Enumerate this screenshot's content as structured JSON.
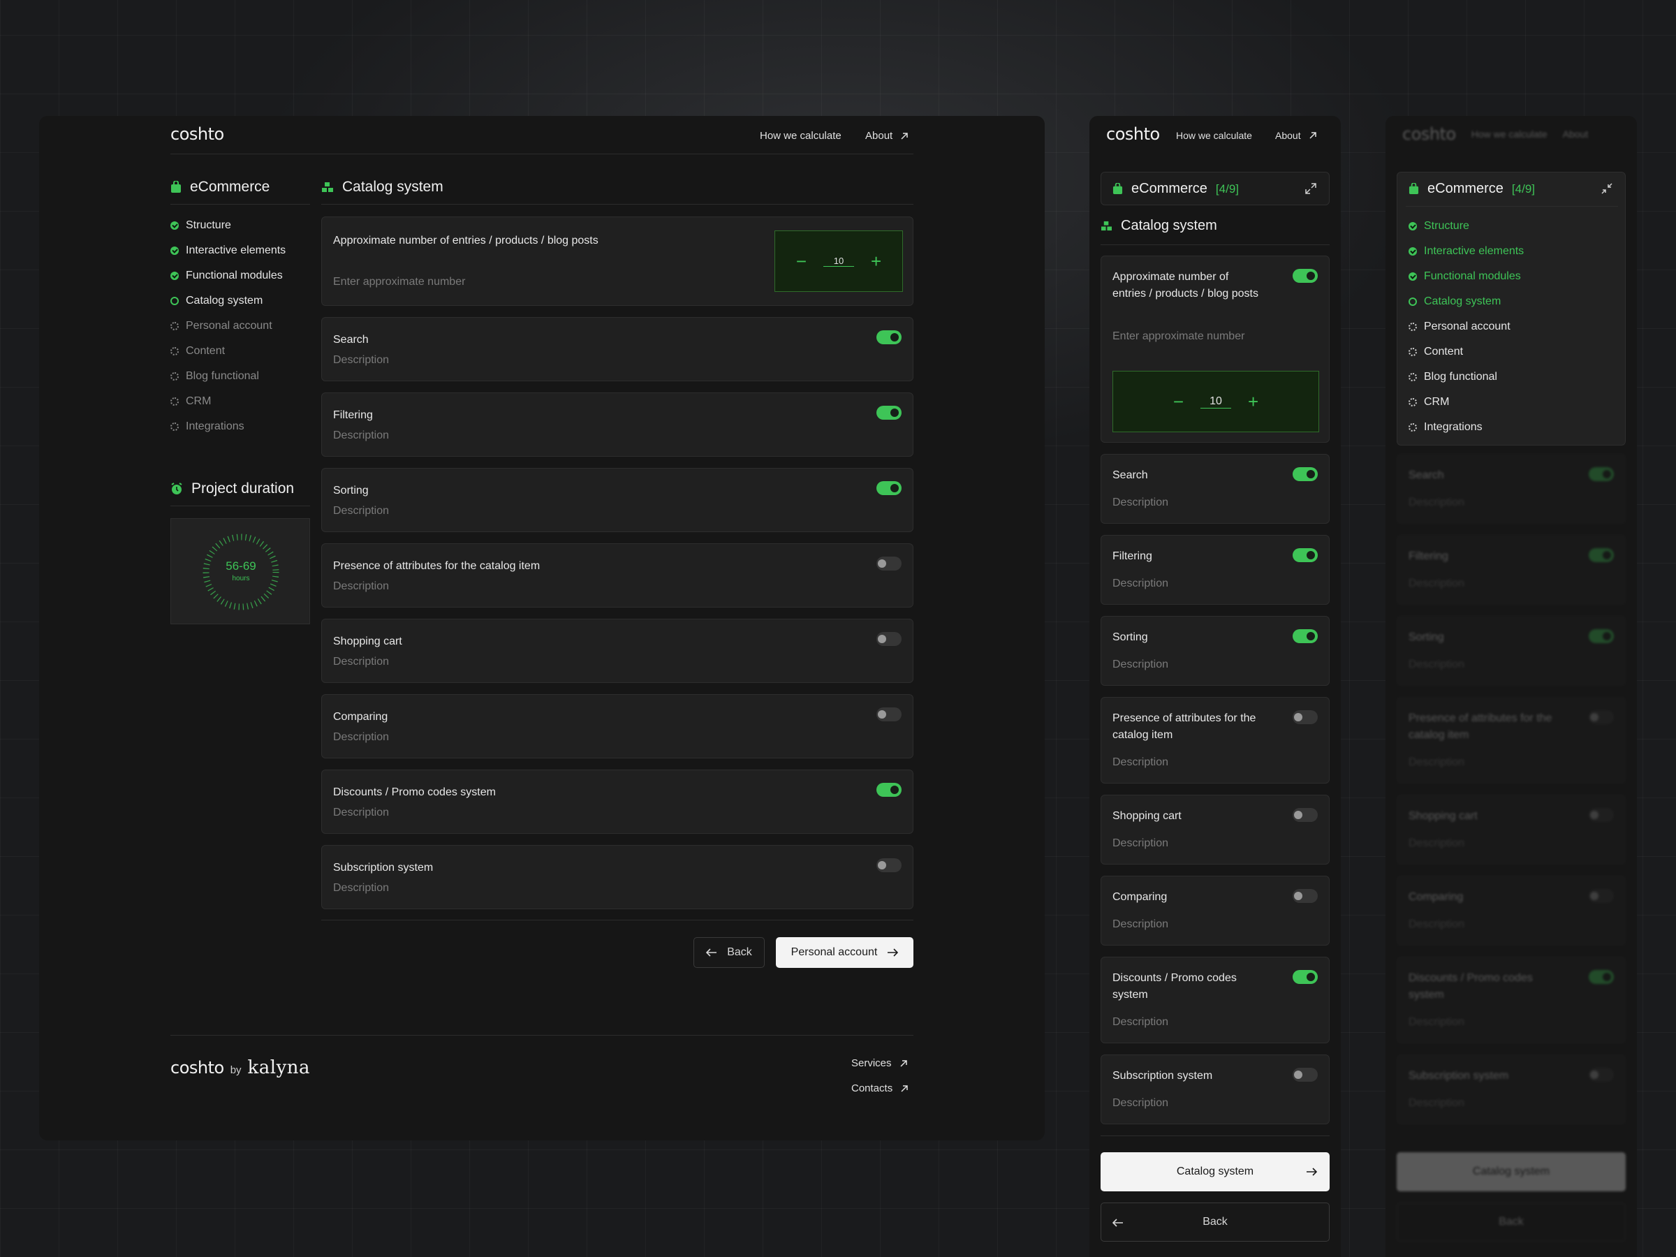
{
  "brand": {
    "logo": "coshto",
    "by": "by",
    "partner": "kalyna"
  },
  "nav": {
    "how": "How we calculate",
    "about": "About"
  },
  "sidebar": {
    "title": "eCommerce",
    "progress": "[4/9]",
    "steps": [
      {
        "label": "Structure",
        "state": "done"
      },
      {
        "label": "Interactive elements",
        "state": "done"
      },
      {
        "label": "Functional modules",
        "state": "done"
      },
      {
        "label": "Catalog system",
        "state": "current"
      },
      {
        "label": "Personal account",
        "state": "todo"
      },
      {
        "label": "Content",
        "state": "todo"
      },
      {
        "label": "Blog functional",
        "state": "todo"
      },
      {
        "label": "CRM",
        "state": "todo"
      },
      {
        "label": "Integrations",
        "state": "todo"
      }
    ]
  },
  "duration": {
    "title": "Project duration",
    "value": "56-69",
    "unit": "hours"
  },
  "main": {
    "title": "Catalog system",
    "entries": {
      "label": "Approximate number of entries / products / blog posts",
      "placeholder": "Enter approximate number",
      "value": "10",
      "minus": "−",
      "plus": "+"
    },
    "options": [
      {
        "label": "Search",
        "desc": "Description",
        "on": true
      },
      {
        "label": "Filtering",
        "desc": "Description",
        "on": true
      },
      {
        "label": "Sorting",
        "desc": "Description",
        "on": true
      },
      {
        "label": "Presence of attributes for the catalog item",
        "desc": "Description",
        "on": false
      },
      {
        "label": "Shopping cart",
        "desc": "Description",
        "on": false
      },
      {
        "label": "Comparing",
        "desc": "Description",
        "on": false
      },
      {
        "label": "Discounts / Promo codes system",
        "desc": "Description",
        "on": true
      },
      {
        "label": "Subscription system",
        "desc": "Description",
        "on": false
      }
    ]
  },
  "actions": {
    "back": "Back",
    "next": "Personal account",
    "next_mobile": "Catalog system"
  },
  "footer": {
    "services": "Services",
    "contacts": "Contacts"
  },
  "colors": {
    "accent": "#3ec457",
    "bg": "#161616",
    "card": "#202020"
  }
}
